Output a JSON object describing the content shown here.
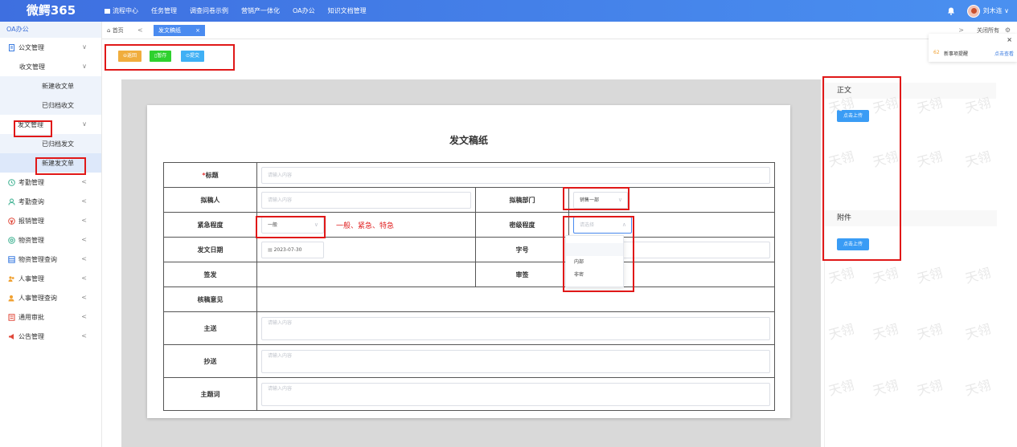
{
  "app": {
    "logo": "微鳄365",
    "user_name": "刘木连 ∨"
  },
  "top_nav": [
    "流程中心",
    "任务管理",
    "调查问卷示例",
    "营销产一体化",
    "OA办公",
    "知识文档管理"
  ],
  "sidebar": {
    "header": "OA办公",
    "items": [
      {
        "label": "公文管理",
        "arrow": "∨"
      },
      {
        "label": "收文管理",
        "arrow": "∨"
      },
      {
        "label": "新建收文单"
      },
      {
        "label": "已归档收文"
      },
      {
        "label": "发文管理",
        "arrow": "∨"
      },
      {
        "label": "已归档发文"
      },
      {
        "label": "新建发文单"
      },
      {
        "label": "考勤管理",
        "arrow": "<"
      },
      {
        "label": "考勤查询",
        "arrow": "<"
      },
      {
        "label": "报销管理",
        "arrow": "<"
      },
      {
        "label": "物资管理",
        "arrow": "<"
      },
      {
        "label": "物资管理查询",
        "arrow": "<"
      },
      {
        "label": "人事管理",
        "arrow": "<"
      },
      {
        "label": "人事管理查询",
        "arrow": "<"
      },
      {
        "label": "通用审批",
        "arrow": "<"
      },
      {
        "label": "公告管理",
        "arrow": "<"
      }
    ]
  },
  "tabs": {
    "home": "首页",
    "back": "<",
    "active": "发文稿纸",
    "close": "×",
    "next": ">",
    "close_all": "关闭所有"
  },
  "toolbar": {
    "back_label": "返回",
    "save_label": "暂存",
    "submit_label": "提交"
  },
  "notice": {
    "count": "62",
    "text": "新事项提醒",
    "link": "点击查看",
    "close": "×"
  },
  "form": {
    "title": "发文稿纸",
    "required_mark": "*",
    "title_label": "标题",
    "drafter_label": "拟稿人",
    "dept_label": "拟稿部门",
    "dept_value": "销售一部",
    "urgency_label": "紧急程度",
    "urgency_value": "一般",
    "urgency_note": "一般、紧急、特急",
    "secret_label": "密级程度",
    "secret_placeholder": "请选择",
    "secret_options": [
      "",
      "内部",
      "非密"
    ],
    "date_label": "发文日期",
    "date_value": "2023-07-30",
    "docno_label": "字号",
    "sign_label": "签发",
    "review_label": "审签",
    "check_label": "核稿意见",
    "to_label": "主送",
    "cc_label": "抄送",
    "keywords_label": "主题词",
    "placeholder": "请输入内容"
  },
  "right_panel": {
    "body_title": "正文",
    "upload_label": "点击上传",
    "attach_title": "附件",
    "upload_label2": "点击上传"
  },
  "watermark": "天翎",
  "colors": {
    "accent": "#3a9cf5",
    "red_box": "#e01818",
    "back_btn": "#f0ad3d",
    "save_btn": "#2ed12e",
    "submit_btn": "#3fb0f5"
  }
}
